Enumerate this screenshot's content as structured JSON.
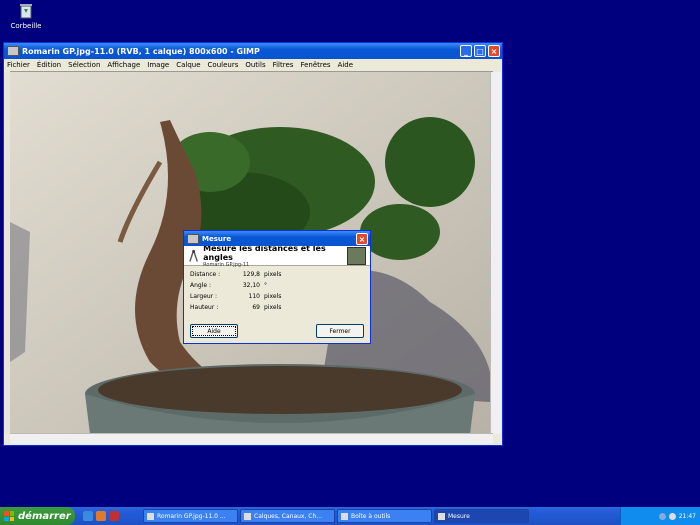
{
  "desktop": {
    "recycle_bin_label": "Corbeille"
  },
  "gimp": {
    "title": "Romarin GP.jpg-11.0 (RVB, 1 calque) 800x600 - GIMP",
    "menu": [
      "Fichier",
      "Édition",
      "Sélection",
      "Affichage",
      "Image",
      "Calque",
      "Couleurs",
      "Outils",
      "Filtres",
      "Fenêtres",
      "Aide"
    ],
    "controls": {
      "minimize": "_",
      "maximize": "□",
      "close": "×"
    }
  },
  "measure_dialog": {
    "title": "Mesure",
    "heading": "Mesure les distances et les angles",
    "subheading": "Romarin GP.jpg-11",
    "rows": [
      {
        "label": "Distance :",
        "value": "129,8",
        "unit": "pixels"
      },
      {
        "label": "Angle :",
        "value": "32,10",
        "unit": "°"
      },
      {
        "label": "Largeur :",
        "value": "110",
        "unit": "pixels"
      },
      {
        "label": "Hauteur :",
        "value": "69",
        "unit": "pixels"
      }
    ],
    "help_button": "Aide",
    "close_button": "Fermer",
    "close_icon": "×"
  },
  "taskbar": {
    "start_label": "démarrer",
    "tasks": [
      {
        "label": "Romarin GP.jpg-11.0 ..."
      },
      {
        "label": "Calques, Canaux, Ch..."
      },
      {
        "label": "Boîte à outils"
      },
      {
        "label": "Mesure"
      }
    ],
    "lang": "FR",
    "clock": "21:47"
  },
  "colors": {
    "desktop": "#00007f",
    "titlebar": "#0a57d6",
    "start": "#2f8a2f"
  }
}
